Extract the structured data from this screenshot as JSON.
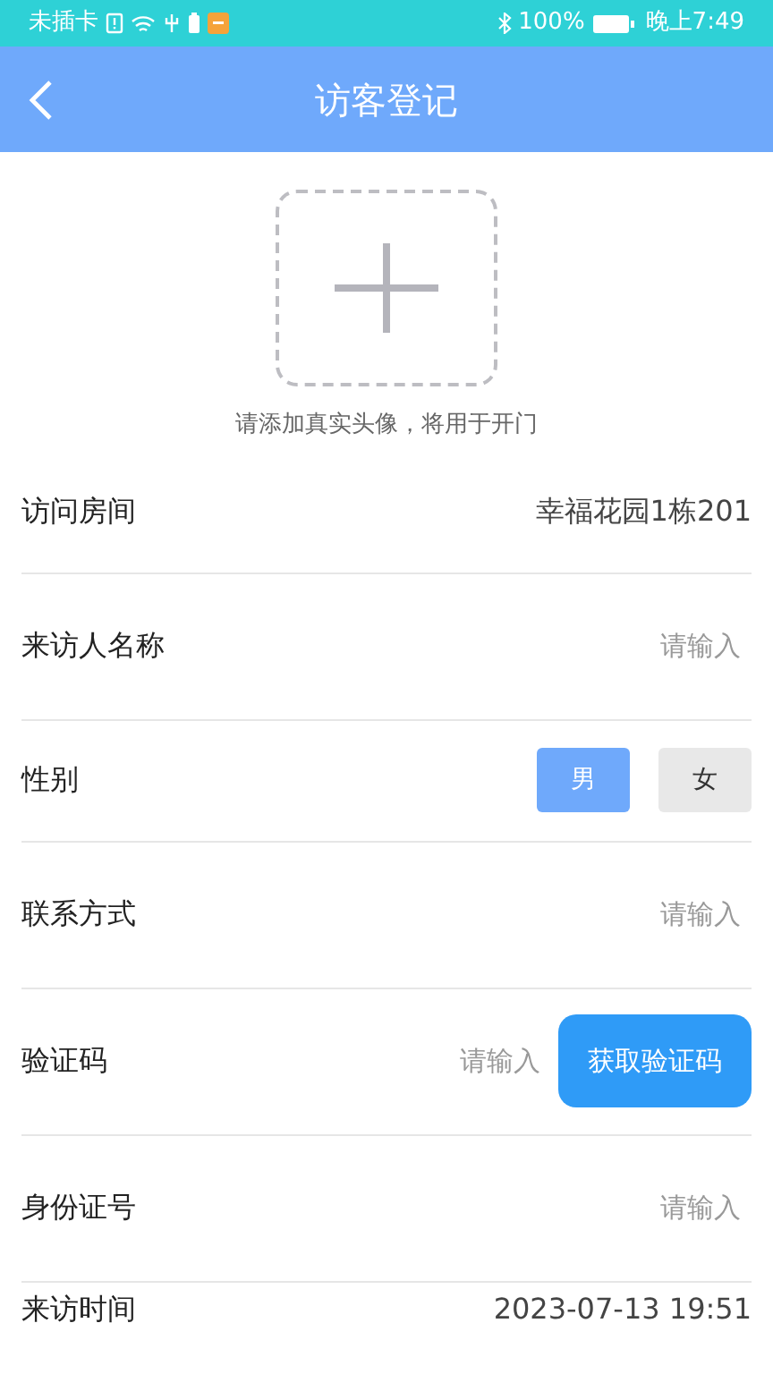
{
  "status_bar": {
    "left": "未插卡",
    "battery": "100%",
    "time": "晚上7:49"
  },
  "header": {
    "title": "访客登记"
  },
  "photo": {
    "hint": "请添加真实头像，将用于开门"
  },
  "rows": [
    {
      "kind": "value",
      "label": "访问房间",
      "value": "幸福花园1栋201"
    },
    {
      "kind": "input",
      "label": "来访人名称",
      "placeholder": "请输入"
    },
    {
      "kind": "choice",
      "label": "性别",
      "options": [
        {
          "label": "男",
          "selected": true
        },
        {
          "label": "女",
          "selected": false
        }
      ]
    },
    {
      "kind": "input",
      "label": "联系方式",
      "placeholder": "请输入"
    },
    {
      "kind": "code",
      "label": "验证码",
      "placeholder": "请输入",
      "button": "获取验证码"
    },
    {
      "kind": "input",
      "label": "身份证号",
      "placeholder": "请输入"
    },
    {
      "kind": "value",
      "label": "来访时间",
      "value": "2023-07-13 19:51"
    }
  ]
}
